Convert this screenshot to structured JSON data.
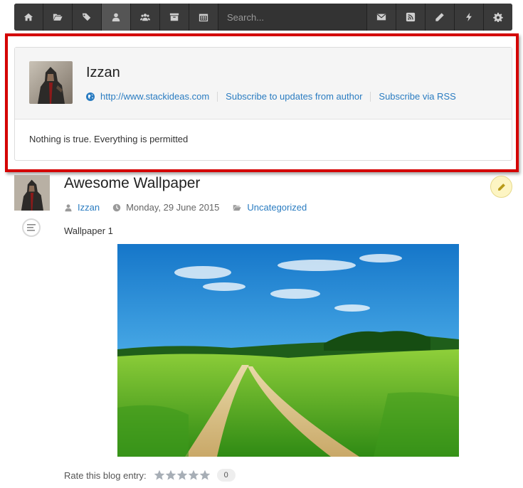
{
  "toolbar": {
    "left_buttons": [
      "home-icon",
      "folder-icon",
      "tags-icon",
      "user-icon",
      "users-icon",
      "archive-icon",
      "calendar-icon"
    ],
    "active_button": "user-icon",
    "search_placeholder": "Search...",
    "right_buttons": [
      "envelope-icon",
      "rss-icon",
      "pencil-icon",
      "bolt-icon",
      "gear-icon"
    ]
  },
  "author": {
    "name": "Izzan",
    "website": "http://www.stackideas.com",
    "subscribe_author": "Subscribe to updates from author",
    "subscribe_rss": "Subscribe via RSS",
    "bio": "Nothing is true. Everything is permitted"
  },
  "post": {
    "title": "Awesome Wallpaper",
    "author": "Izzan",
    "date": "Monday, 29 June 2015",
    "category": "Uncategorized",
    "intro": "Wallpaper 1",
    "rating_label": "Rate this blog entry:",
    "rating_count": "0",
    "rating_value": 0,
    "stars_total": 5
  },
  "colors": {
    "link": "#2a7cc1",
    "highlight_border": "#d40000",
    "toolbar_bg": "#333333"
  }
}
